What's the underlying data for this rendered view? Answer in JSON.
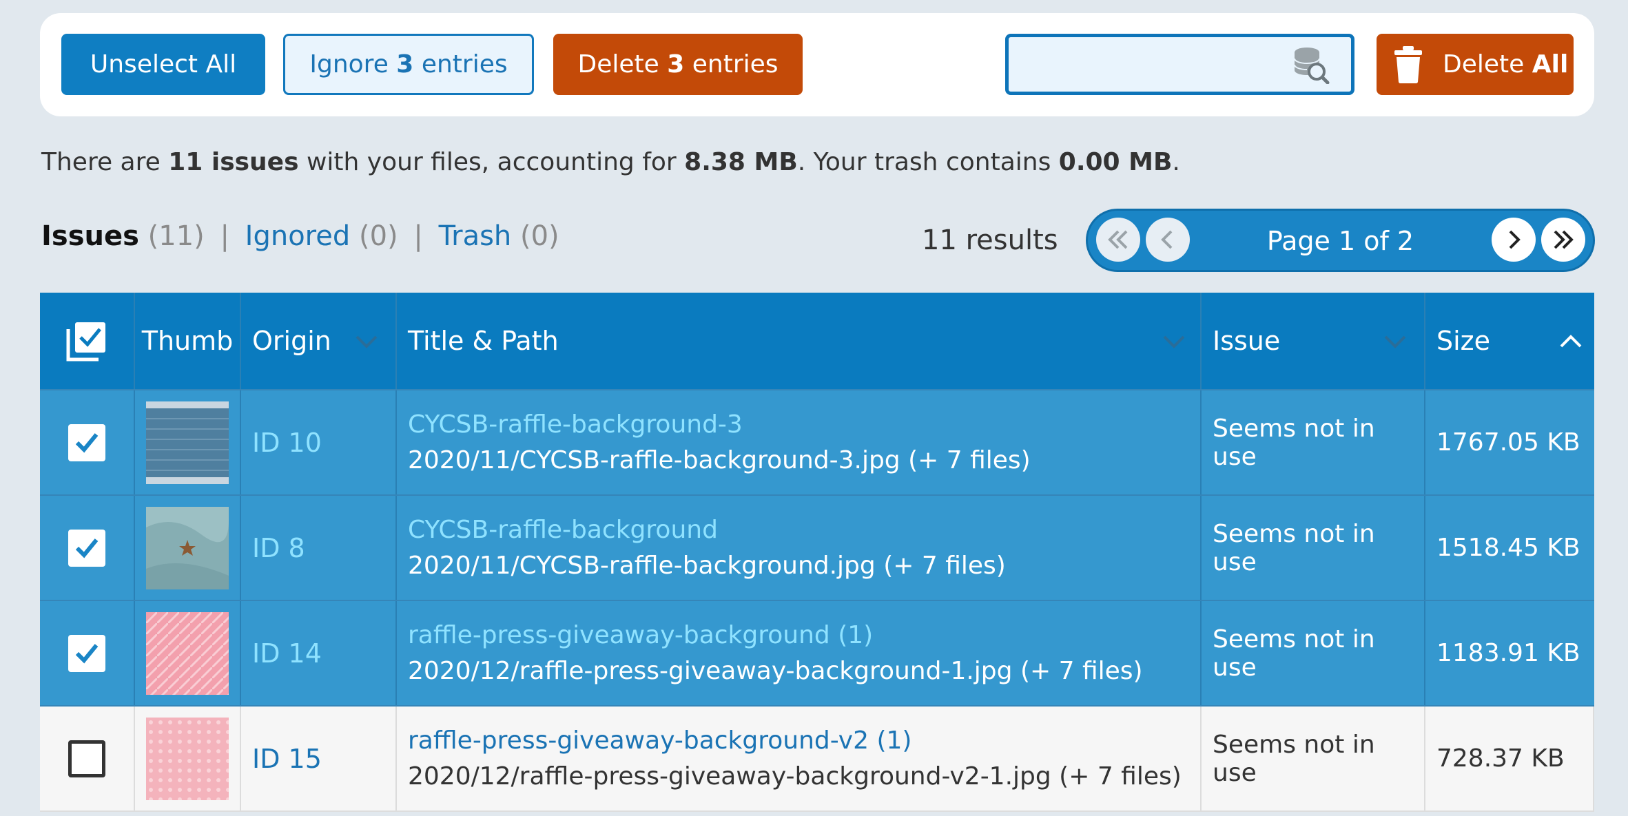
{
  "toolbar": {
    "unselect_label": "Unselect All",
    "ignore_prefix": "Ignore",
    "ignore_count": "3",
    "ignore_suffix": "entries",
    "delete_prefix": "Delete",
    "delete_count": "3",
    "delete_suffix": "entries",
    "search_value": "",
    "delete_all_prefix": "Delete",
    "delete_all_bold": "All"
  },
  "summary": {
    "t1": "There are ",
    "issues": "11 issues",
    "t2": " with your files, accounting for ",
    "size": "8.38 MB",
    "t3": ". Your trash contains ",
    "trash": "0.00 MB",
    "t4": "."
  },
  "tabs": {
    "issues_label": "Issues",
    "issues_count": "(11)",
    "ignored_label": "Ignored",
    "ignored_count": "(0)",
    "trash_label": "Trash",
    "trash_count": "(0)"
  },
  "results": "11 results",
  "pager": {
    "label": "Page 1 of 2"
  },
  "table": {
    "headers": {
      "thumb": "Thumb",
      "origin": "Origin",
      "title": "Title & Path",
      "issue": "Issue",
      "size": "Size"
    },
    "rows": [
      {
        "selected": true,
        "origin": "ID 10",
        "title": "CYCSB-raffle-background-3",
        "path": "2020/11/CYCSB-raffle-background-3.jpg (+ 7 files)",
        "issue": "Seems not in use",
        "size": "1767.05 KB"
      },
      {
        "selected": true,
        "origin": "ID 8",
        "title": "CYCSB-raffle-background",
        "path": "2020/11/CYCSB-raffle-background.jpg (+ 7 files)",
        "issue": "Seems not in use",
        "size": "1518.45 KB"
      },
      {
        "selected": true,
        "origin": "ID 14",
        "title": "raffle-press-giveaway-background (1)",
        "path": "2020/12/raffle-press-giveaway-background-1.jpg (+ 7 files)",
        "issue": "Seems not in use",
        "size": "1183.91 KB"
      },
      {
        "selected": false,
        "origin": "ID 15",
        "title": "raffle-press-giveaway-background-v2 (1)",
        "path": "2020/12/raffle-press-giveaway-background-v2-1.jpg (+ 7 files)",
        "issue": "Seems not in use",
        "size": "728.37 KB"
      }
    ]
  },
  "colors": {
    "primary": "#0f7ec2",
    "danger": "#c34a08",
    "selected_row": "#3598cf",
    "header_row": "#0a7bbf"
  }
}
